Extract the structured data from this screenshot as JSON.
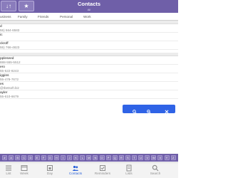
{
  "header": {
    "title": "Contacts",
    "subtitle": "All",
    "left_buttons": [
      {
        "icon": "sort-icon",
        "glyph": "↓↑"
      },
      {
        "icon": "star-icon",
        "glyph": "★"
      }
    ]
  },
  "tabs": [
    "usiness",
    "Family",
    "Friends",
    "Personal",
    "Work"
  ],
  "contacts": [
    {
      "section": true
    },
    {
      "name": "d",
      "detail": "55) 564-6583"
    },
    {
      "name": "ic",
      "detail": ""
    },
    {
      "name": "ckroff",
      "detail": "55) 766-4823"
    },
    {
      "section": true
    },
    {
      "name": "ppleseed",
      "detail": "888-555-5512"
    },
    {
      "name": "ero",
      "detail": "55-522-8243"
    },
    {
      "name": "iggins",
      "detail": "55-478-7672"
    },
    {
      "name": "es",
      "detail": "@tbetsoft.biz"
    },
    {
      "name": "ayler",
      "detail": "55-610-6679"
    }
  ],
  "floating_bar": {
    "icons": [
      "search-icon",
      "zoom-icon",
      "close-icon"
    ]
  },
  "alphabet": [
    "#",
    "A",
    "B",
    "C",
    "D",
    "E",
    "F",
    "G",
    "H",
    "I",
    "J",
    "K",
    "L",
    "M",
    "N",
    "O",
    "P",
    "Q",
    "R",
    "S",
    "T",
    "U",
    "V",
    "W",
    "X",
    "Y",
    "Z"
  ],
  "toolbar": {
    "items": [
      {
        "icon": "list-icon",
        "label": "List"
      },
      {
        "icon": "week-icon",
        "label": "Week"
      },
      {
        "icon": "day-icon",
        "label": "Day"
      },
      {
        "icon": "contacts-icon",
        "label": "Contacts",
        "active": true
      },
      {
        "icon": "reminders-icon",
        "label": "Reminders"
      },
      {
        "icon": "lists-icon",
        "label": "Lists"
      },
      {
        "icon": "search-icon",
        "label": "Search"
      }
    ]
  },
  "colors": {
    "header": "#6f5fa8",
    "active": "#2a62d9",
    "floating_bar": "#2f63e6"
  }
}
